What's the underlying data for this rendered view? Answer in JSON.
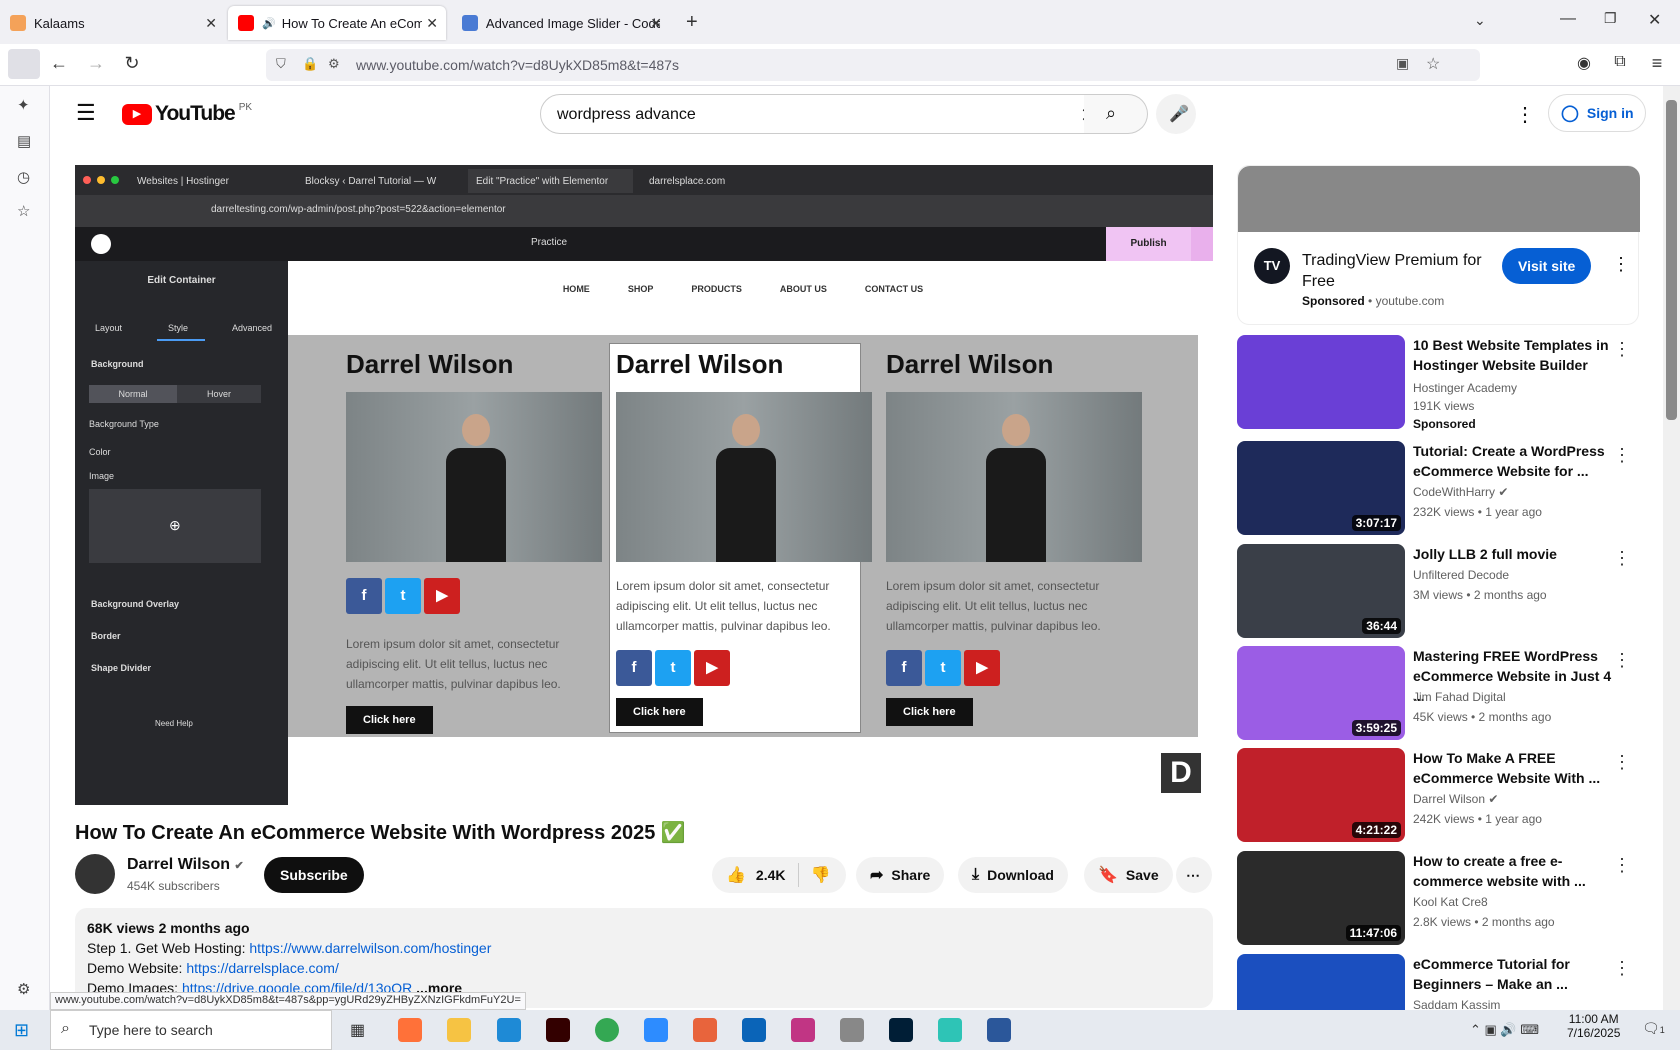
{
  "browser": {
    "tabs": [
      {
        "label": "Kalaams",
        "active": false
      },
      {
        "label": "How To Create An eComme",
        "active": true
      },
      {
        "label": "Advanced Image Slider - Code",
        "active": false
      }
    ],
    "new_tab": "+",
    "url": "www.youtube.com/watch?v=d8UykXD85m8&t=487s",
    "status_url": "www.youtube.com/watch?v=d8UykXD85m8&t=487s&pp=ygURd29yZHByZXNzIGFkdmFuY2U="
  },
  "youtube": {
    "logo": "YouTube",
    "region": "PK",
    "search_value": "wordpress advance",
    "sign_in": "Sign in"
  },
  "video": {
    "mac_tabs": [
      "Websites | Hostinger",
      "Blocksy ‹ Darrel Tutorial — W",
      "Edit \"Practice\" with Elementor",
      "darrelsplace.com"
    ],
    "mac_url": "darreltesting.com/wp-admin/post.php?post=522&action=elementor",
    "el_page": "Practice",
    "el_publish": "Publish",
    "panel": {
      "title": "Edit Container",
      "tabs": [
        "Layout",
        "Style",
        "Advanced"
      ],
      "section": "Background",
      "states": [
        "Normal",
        "Hover"
      ],
      "bg_type": "Background Type",
      "color": "Color",
      "image": "Image",
      "sections": [
        "Background Overlay",
        "Border",
        "Shape Divider"
      ],
      "help": "Need Help"
    },
    "menu": [
      "HOME",
      "SHOP",
      "PRODUCTS",
      "ABOUT US",
      "CONTACT US"
    ],
    "cards": [
      {
        "name": "Darrel Wilson",
        "lorem": "Lorem ipsum dolor sit amet, consectetur adipiscing elit. Ut elit tellus, luctus nec ullamcorper mattis, pulvinar dapibus leo.",
        "btn": "Click here"
      },
      {
        "name": "Darrel Wilson",
        "lorem": "Lorem ipsum dolor sit amet, consectetur adipiscing elit. Ut elit tellus, luctus nec ullamcorper mattis, pulvinar dapibus leo.",
        "btn": "Click here"
      },
      {
        "name": "Darrel Wilson",
        "lorem": "Lorem ipsum dolor sit amet, consectetur adipiscing elit. Ut elit tellus, luctus nec ullamcorper mattis, pulvinar dapibus leo.",
        "btn": "Click here"
      }
    ]
  },
  "meta": {
    "title": "How To Create An eCommerce Website With Wordpress 2025 ✅",
    "channel": "Darrel Wilson",
    "subscribers": "454K subscribers",
    "subscribe": "Subscribe",
    "likes": "2.4K",
    "share": "Share",
    "download": "Download",
    "save": "Save"
  },
  "description": {
    "stats": "68K views  2 months ago",
    "line1_prefix": "Step 1. Get Web Hosting: ",
    "line1_link": "https://www.darrelwilson.com/hostinger",
    "line2_prefix": "Demo Website: ",
    "line2_link": "https://darrelsplace.com/",
    "line3_prefix": "Demo Images: ",
    "line3_link": "https://drive.google.com/file/d/13oQR",
    "more": "...more"
  },
  "ad": {
    "title": "TradingView Premium for Free",
    "sponsored": "Sponsored",
    "domain": "youtube.com",
    "visit": "Visit site"
  },
  "recs": [
    {
      "title": "10 Best Website Templates in Hostinger Website Builder",
      "channel": "Hostinger Academy",
      "stats": "191K views",
      "extra": "Sponsored",
      "duration": "",
      "color": "#6a3fd6"
    },
    {
      "title": "Tutorial: Create a WordPress eCommerce Website for ...",
      "channel": "CodeWithHarry",
      "stats": "232K views • 1 year ago",
      "extra": "",
      "duration": "3:07:17",
      "color": "#1e2a5a"
    },
    {
      "title": "Jolly LLB 2 full movie",
      "channel": "Unfiltered Decode",
      "stats": "3M views • 2 months ago",
      "extra": "",
      "duration": "36:44",
      "color": "#3a3f48"
    },
    {
      "title": "Mastering FREE WordPress eCommerce Website in Just 4 ...",
      "channel": "Jim Fahad Digital",
      "stats": "45K views • 2 months ago",
      "extra": "",
      "duration": "3:59:25",
      "color": "#9b5de5"
    },
    {
      "title": "How To Make A FREE eCommerce Website With ...",
      "channel": "Darrel Wilson",
      "stats": "242K views • 1 year ago",
      "extra": "",
      "duration": "4:21:22",
      "color": "#c0202a"
    },
    {
      "title": "How to create a free e-commerce website with ...",
      "channel": "Kool Kat Cre8",
      "stats": "2.8K views • 2 months ago",
      "extra": "",
      "duration": "11:47:06",
      "color": "#2b2b2b"
    },
    {
      "title": "eCommerce Tutorial for Beginners – Make an ...",
      "channel": "Saddam Kassim",
      "stats": "",
      "extra": "",
      "duration": "",
      "color": "#1b4fbf"
    }
  ],
  "taskbar": {
    "search_placeholder": "Type here to search",
    "time": "11:00 AM",
    "date": "7/16/2025",
    "notif": "1"
  }
}
